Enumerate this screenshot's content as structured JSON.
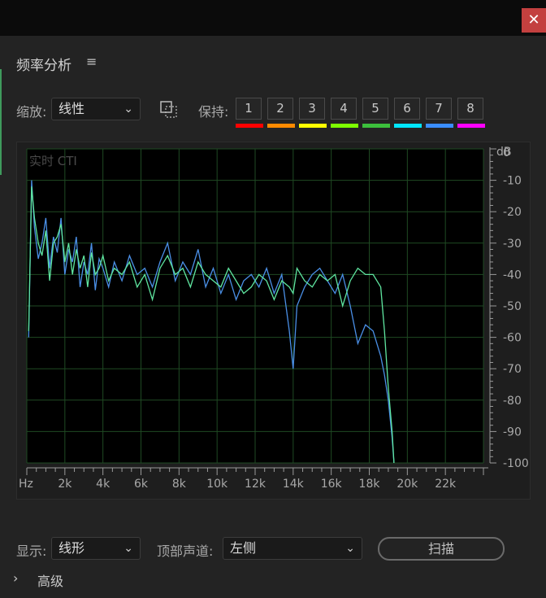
{
  "window": {
    "close_label": "✕"
  },
  "panel": {
    "title": "频率分析",
    "menu_icon": "hamburger-menu-icon"
  },
  "zoom": {
    "label": "缩放:",
    "value": "线性"
  },
  "hold": {
    "label": "保持:",
    "buttons": [
      "1",
      "2",
      "3",
      "4",
      "5",
      "6",
      "7",
      "8"
    ],
    "colors": [
      "#ff0000",
      "#ff8a00",
      "#ffff00",
      "#7dff00",
      "#3cbf3c",
      "#00e6ff",
      "#3a8dff",
      "#ff00ff"
    ]
  },
  "graph": {
    "overlay_text": "实时 CTI",
    "db_unit": "dB",
    "db_labels": [
      "0",
      "-10",
      "-20",
      "-30",
      "-40",
      "-50",
      "-60",
      "-70",
      "-80",
      "-90",
      "-100"
    ],
    "freq_labels": [
      "Hz",
      "2k",
      "4k",
      "6k",
      "8k",
      "10k",
      "12k",
      "14k",
      "16k",
      "18k",
      "20k",
      "22k"
    ]
  },
  "chart_data": {
    "type": "line",
    "xlabel": "",
    "ylabel": "dB",
    "xlim": [
      0,
      24000
    ],
    "ylim": [
      -100,
      0
    ],
    "grid": true,
    "colors": {
      "series_blue": "#4a8fe6",
      "series_green": "#5fe6a0"
    },
    "series": [
      {
        "x": [
          100,
          250,
          400,
          600,
          800,
          1000,
          1200,
          1400,
          1600,
          1800,
          2000,
          2200,
          2400,
          2600,
          2800,
          3000,
          3200,
          3400,
          3600,
          3800,
          4000,
          4300,
          4600,
          5000,
          5400,
          5800,
          6200,
          6600,
          7000,
          7400,
          7800,
          8200,
          8600,
          9000,
          9400,
          9800,
          10200,
          10600,
          11000,
          11400,
          11800,
          12200,
          12600,
          13000,
          13400,
          13800,
          14000,
          14200,
          14600,
          15000,
          15400,
          15800,
          16200,
          16600,
          17000,
          17400,
          17800,
          18200,
          18600,
          18800,
          19000,
          19200,
          19300
        ],
        "values": [
          -60,
          -10,
          -25,
          -35,
          -30,
          -22,
          -38,
          -28,
          -33,
          -22,
          -40,
          -32,
          -36,
          -28,
          -44,
          -36,
          -40,
          -30,
          -45,
          -35,
          -38,
          -44,
          -36,
          -42,
          -34,
          -40,
          -38,
          -44,
          -36,
          -30,
          -42,
          -36,
          -40,
          -32,
          -44,
          -38,
          -46,
          -40,
          -48,
          -42,
          -40,
          -44,
          -38,
          -46,
          -40,
          -58,
          -70,
          -50,
          -44,
          -40,
          -38,
          -42,
          -46,
          -40,
          -50,
          -62,
          -56,
          -58,
          -66,
          -72,
          -80,
          -92,
          -100
        ]
      },
      {
        "x": [
          100,
          250,
          400,
          600,
          800,
          1000,
          1200,
          1400,
          1600,
          1800,
          2000,
          2200,
          2400,
          2600,
          2800,
          3000,
          3200,
          3400,
          3600,
          3800,
          4000,
          4300,
          4600,
          5000,
          5400,
          5800,
          6200,
          6600,
          7000,
          7400,
          7800,
          8200,
          8600,
          9000,
          9400,
          9800,
          10200,
          10600,
          11000,
          11400,
          11800,
          12200,
          12600,
          13000,
          13400,
          13800,
          14000,
          14200,
          14600,
          15000,
          15400,
          15800,
          16200,
          16600,
          17000,
          17400,
          17800,
          18200,
          18600,
          18800,
          19000,
          19200,
          19300
        ],
        "values": [
          -58,
          -12,
          -22,
          -30,
          -34,
          -26,
          -42,
          -30,
          -28,
          -24,
          -36,
          -30,
          -40,
          -32,
          -38,
          -34,
          -44,
          -33,
          -40,
          -38,
          -34,
          -42,
          -38,
          -40,
          -36,
          -44,
          -40,
          -48,
          -38,
          -34,
          -40,
          -38,
          -44,
          -36,
          -40,
          -42,
          -44,
          -38,
          -42,
          -46,
          -44,
          -40,
          -42,
          -48,
          -42,
          -44,
          -46,
          -38,
          -42,
          -44,
          -40,
          -42,
          -40,
          -50,
          -42,
          -38,
          -40,
          -40,
          -44,
          -58,
          -76,
          -90,
          -100
        ]
      }
    ]
  },
  "display": {
    "label": "显示:",
    "value": "线形"
  },
  "top_channel": {
    "label": "顶部声道:",
    "value": "左侧"
  },
  "scan_button": {
    "label": "扫描"
  },
  "advanced": {
    "label": "高级"
  }
}
